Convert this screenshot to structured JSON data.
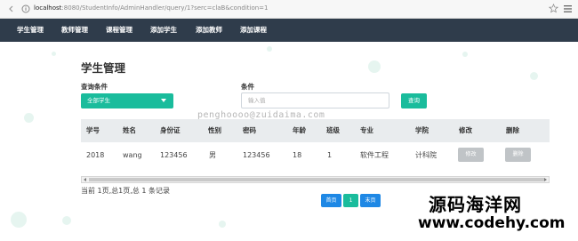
{
  "browser": {
    "url_host": "localhost",
    "url_rest": ":8080/StudentInfo/AdminHandler/query/1?serc=claB&condition=1"
  },
  "nav": {
    "items": [
      "学生管理",
      "教师管理",
      "课程管理",
      "添加学生",
      "添加教师",
      "添加课程"
    ]
  },
  "page": {
    "title": "学生管理",
    "query_label": "查询条件",
    "condition_label": "条件",
    "select_value": "全部学生",
    "input_placeholder": "输入值",
    "search_button": "查询",
    "watermark": "penghoooo@zuidaima.com"
  },
  "table": {
    "headers": [
      "学号",
      "姓名",
      "身份证",
      "性别",
      "密码",
      "年龄",
      "班级",
      "专业",
      "学院",
      "修改",
      "删除"
    ],
    "rows": [
      {
        "id": "2018",
        "name": "wang",
        "id_card": "123456",
        "gender": "男",
        "password": "123456",
        "age": "18",
        "class": "1",
        "major": "软件工程",
        "college": "计科院",
        "edit": "修改",
        "delete": "删除"
      }
    ]
  },
  "footer": {
    "record_info": "当前 1页,总1页,总 1 条记录",
    "pager": {
      "first": "首页",
      "current": "1",
      "last": "末页"
    }
  },
  "brand": {
    "cn": "源码海洋网",
    "en": "www.codehy.com"
  },
  "colors": {
    "accent": "#1abc9c",
    "nav_bg": "#2f3c4b",
    "pager_blue": "#1e88e5",
    "pager_current": "#1abc9c",
    "grey_button": "#c0c4c7"
  }
}
